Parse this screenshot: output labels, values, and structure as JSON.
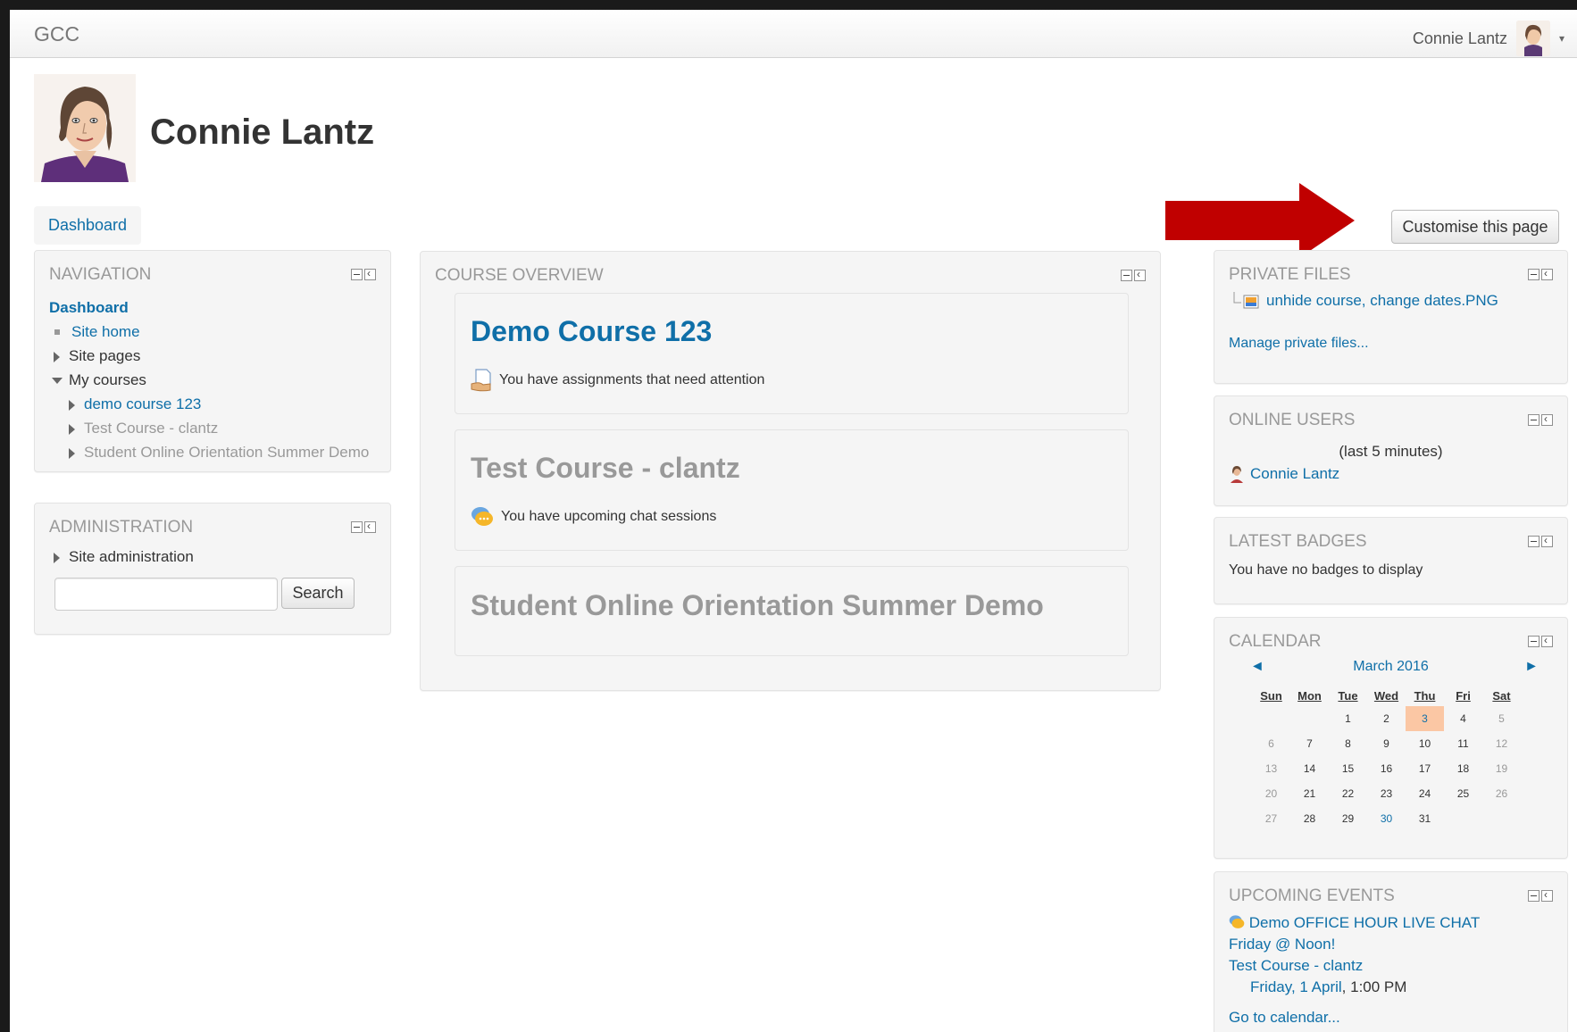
{
  "navbar": {
    "brand": "GCC",
    "user_name": "Connie Lantz"
  },
  "header": {
    "title": "Connie Lantz",
    "breadcrumb": "Dashboard",
    "customise_button": "Customise this page"
  },
  "navigation": {
    "title": "NAVIGATION",
    "dashboard": "Dashboard",
    "site_home": "Site home",
    "site_pages": "Site pages",
    "my_courses": "My courses",
    "courses": [
      "demo course 123",
      "Test Course - clantz",
      "Student Online Orientation Summer Demo"
    ]
  },
  "administration": {
    "title": "ADMINISTRATION",
    "site_admin": "Site administration",
    "search_button": "Search",
    "search_value": ""
  },
  "course_overview": {
    "title": "COURSE OVERVIEW",
    "courses": [
      {
        "name": "Demo Course 123",
        "message": "You have assignments that need attention"
      },
      {
        "name": "Test Course - clantz",
        "message": "You have upcoming chat sessions"
      },
      {
        "name": "Student Online Orientation Summer Demo"
      }
    ]
  },
  "private_files": {
    "title": "PRIVATE FILES",
    "file": "unhide course, change dates.PNG",
    "manage": "Manage private files..."
  },
  "online_users": {
    "title": "ONLINE USERS",
    "note": "(last 5 minutes)",
    "user": "Connie Lantz"
  },
  "latest_badges": {
    "title": "LATEST BADGES",
    "message": "You have no badges to display"
  },
  "calendar": {
    "title": "CALENDAR",
    "month": "March 2016",
    "prev": "◄",
    "next": "►",
    "days": [
      "Sun",
      "Mon",
      "Tue",
      "Wed",
      "Thu",
      "Fri",
      "Sat"
    ],
    "weeks": [
      [
        "",
        "",
        "1",
        "2",
        "3",
        "4",
        "5"
      ],
      [
        "6",
        "7",
        "8",
        "9",
        "10",
        "11",
        "12"
      ],
      [
        "13",
        "14",
        "15",
        "16",
        "17",
        "18",
        "19"
      ],
      [
        "20",
        "21",
        "22",
        "23",
        "24",
        "25",
        "26"
      ],
      [
        "27",
        "28",
        "29",
        "30",
        "31",
        "",
        ""
      ]
    ],
    "today": "3",
    "event_day": "30",
    "today_color": "#fbc7a4"
  },
  "upcoming_events": {
    "title": "UPCOMING EVENTS",
    "event_title": "Demo OFFICE HOUR LIVE CHAT Friday @ Noon!",
    "course": "Test Course - clantz",
    "date_link": "Friday, 1 April",
    "time": ", 1:00 PM",
    "go_to_calendar": "Go to calendar..."
  },
  "colors": {
    "link": "#0f6fa8",
    "arrow": "#c00000"
  }
}
